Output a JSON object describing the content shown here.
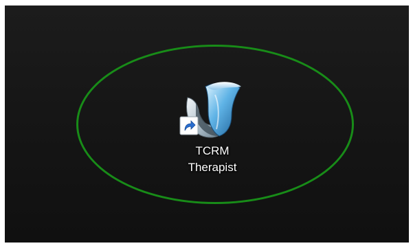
{
  "desktop": {
    "background_color": "#151515",
    "highlight_color": "#188c18",
    "shortcut": {
      "icon": "tcrm-therapist-app-icon",
      "overlay_icon": "shortcut-arrow-icon",
      "label_line1": "TCRM",
      "label_line2": "Therapist"
    }
  }
}
